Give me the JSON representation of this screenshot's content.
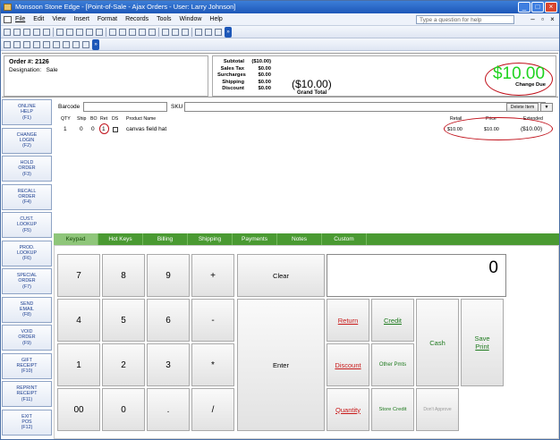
{
  "window": {
    "title": "Monsoon Stone Edge - [Point-of-Sale - Ajax Orders - User: Larry Johnson]"
  },
  "menu": {
    "items": [
      "File",
      "Edit",
      "View",
      "Insert",
      "Format",
      "Records",
      "Tools",
      "Window",
      "Help"
    ],
    "help_placeholder": "Type a question for help"
  },
  "order": {
    "number": "Order #: 2126",
    "designation_label": "Designation:",
    "designation": "Sale"
  },
  "totals": {
    "labels": [
      "Subtotal",
      "Sales Tax",
      "Surcharges",
      "Shipping",
      "Discount"
    ],
    "values": [
      "($10.00)",
      "$0.00",
      "$0.00",
      "$0.00",
      "$0.00"
    ],
    "grand_total": "($10.00)",
    "grand_total_label": "Grand Total",
    "change_due": "$10.00",
    "change_due_label": "Change Due"
  },
  "sidebar": {
    "items": [
      {
        "line1": "ONLINE",
        "line2": "HELP",
        "key": "(F1)"
      },
      {
        "line1": "CHANGE",
        "line2": "LOGIN",
        "key": "(F2)"
      },
      {
        "line1": "HOLD",
        "line2": "ORDER",
        "key": "(F3)"
      },
      {
        "line1": "RECALL",
        "line2": "ORDER",
        "key": "(F4)"
      },
      {
        "line1": "CUST.",
        "line2": "LOOKUP",
        "key": "(F5)"
      },
      {
        "line1": "PROD.",
        "line2": "LOOKUP",
        "key": "(F6)"
      },
      {
        "line1": "SPECIAL",
        "line2": "ORDER",
        "key": "(F7)"
      },
      {
        "line1": "SEND",
        "line2": "EMAIL",
        "key": "(F8)"
      },
      {
        "line1": "VOID",
        "line2": "ORDER",
        "key": "(F9)"
      },
      {
        "line1": "GIFT",
        "line2": "RECEIPT",
        "key": "(F10)"
      },
      {
        "line1": "REPRINT",
        "line2": "RECEIPT",
        "key": "(F11)"
      },
      {
        "line1": "EXIT",
        "line2": "POS",
        "key": "(F12)"
      }
    ]
  },
  "entry": {
    "barcode_label": "Barcode",
    "sku_label": "SKU",
    "delete_item": "Delete Item",
    "dropdown": "▼"
  },
  "grid": {
    "columns": [
      "QTY",
      "Ship",
      "BO",
      "Ret",
      "DS",
      "Product Name",
      "Retail",
      "Price",
      "Extended"
    ],
    "row": {
      "qty": "1",
      "ship": "0",
      "bo": "0",
      "ret": "1",
      "name": "canvas field hat",
      "retail": "$10.00",
      "price": "$10.00",
      "extended": "($10.00)"
    }
  },
  "tabs": [
    "Keypad",
    "Hot Keys",
    "Billing",
    "Shipping",
    "Payments",
    "Notes",
    "Custom"
  ],
  "keypad": {
    "digits": [
      "7",
      "8",
      "9",
      "4",
      "5",
      "6",
      "1",
      "2",
      "3",
      "00",
      "0",
      "."
    ],
    "ops": [
      "+",
      "-",
      "*",
      "/"
    ],
    "clear": "Clear",
    "enter": "Enter",
    "display": "0",
    "return": "Return",
    "credit": "Credit",
    "cash": "Cash",
    "save_print_1": "Save",
    "save_print_2": "Print",
    "discount": "Discount",
    "other_pmts": "Other Pmts",
    "quantity": "Quantity",
    "store_credit": "Store Credit",
    "dont_approve": "Don't Approve"
  }
}
